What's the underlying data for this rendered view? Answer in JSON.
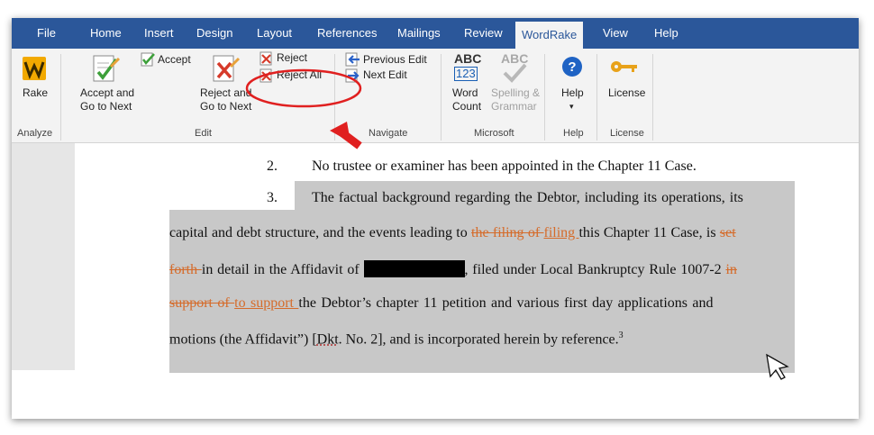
{
  "tabs": [
    "File",
    "Home",
    "Insert",
    "Design",
    "Layout",
    "References",
    "Mailings",
    "Review",
    "WordRake",
    "View",
    "Help"
  ],
  "ribbon": {
    "rake": "Rake",
    "accept_next_1": "Accept and",
    "accept_next_2": "Go to Next",
    "accept": "Accept",
    "reject_next_1": "Reject and",
    "reject_next_2": "Go to Next",
    "reject": "Reject",
    "reject_all": "Reject All",
    "previous_edit": "Previous Edit",
    "next_edit": "Next Edit",
    "word_count_icon_top": "ABC",
    "word_count_icon_bottom": "123",
    "word_count_1": "Word",
    "word_count_2": "Count",
    "spelling_icon": "ABC",
    "spelling_1": "Spelling &",
    "spelling_2": "Grammar",
    "help": "Help",
    "license": "License",
    "groups": {
      "analyze": "Analyze",
      "edit": "Edit",
      "navigate": "Navigate",
      "microsoft": "Microsoft",
      "help": "Help",
      "license": "License"
    }
  },
  "document": {
    "p2_num": "2.",
    "p2_text": "No trustee or examiner has been appointed in the Chapter 11 Case.",
    "p3_num": "3.",
    "p3_line1": "The factual background regarding the Debtor, including its operations, its",
    "line2_a": "capital and debt structure, and the events leading to ",
    "line2_del": "the filing of ",
    "line2_ins": "filing ",
    "line2_b": "this Chapter 11 Case, is ",
    "line2_del2": "set",
    "line3_del": "forth ",
    "line3_a": "in detail in the Affidavit of ",
    "line3_b": ", filed under Local Bankruptcy Rule 1007-2 ",
    "line3_del2": "in",
    "line4_del": "support of ",
    "line4_ins": "to support ",
    "line4_a": "the Debtor’s chapter 11 petition and various first day applications and",
    "line5_a": "motions (the Affidavit”) [",
    "line5_dkt": "Dkt",
    "line5_b": ". No. 2], and is incorporated herein by reference.",
    "line5_sup": "3"
  },
  "colors": {
    "tab_bar": "#2b579a",
    "track_change": "#d56b2a",
    "annotation": "#e02020"
  }
}
